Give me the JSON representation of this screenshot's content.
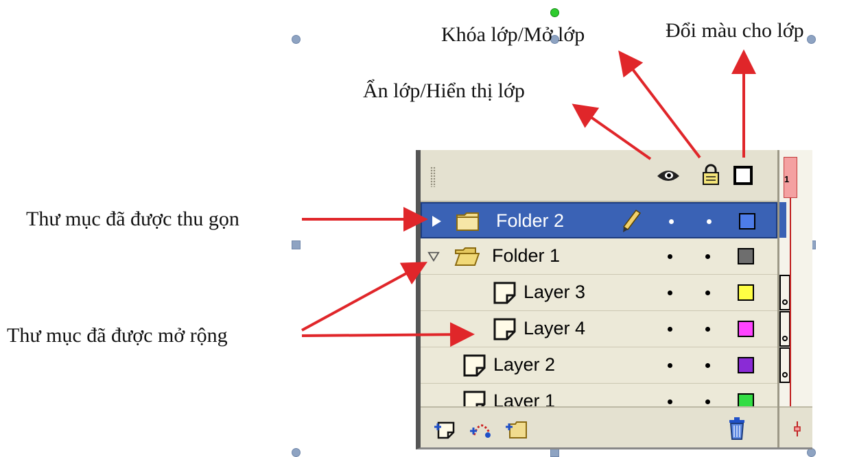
{
  "annotations": {
    "lock": "Khóa lớp/Mở lớp",
    "color": "Đổi màu cho lớp",
    "visibility": "Ẩn lớp/Hiển thị lớp",
    "collapsed": "Thư mục đã được thu gọn",
    "expanded": "Thư mục đã được mở rộng"
  },
  "panel": {
    "frame_number": "1",
    "layers": [
      {
        "name": "Folder 2",
        "kind": "folder",
        "state": "collapsed",
        "selected": true,
        "editing": true,
        "color": "#4d7ce8"
      },
      {
        "name": "Folder 1",
        "kind": "folder",
        "state": "expanded",
        "selected": false,
        "color": "#6e6e6e"
      },
      {
        "name": "Layer 3",
        "kind": "layer",
        "nested": true,
        "color": "#ffff44"
      },
      {
        "name": "Layer 4",
        "kind": "layer",
        "nested": true,
        "color": "#ff44ff"
      },
      {
        "name": "Layer 2",
        "kind": "layer",
        "nested": false,
        "color": "#8a2bd6"
      },
      {
        "name": "Layer 1",
        "kind": "layer",
        "nested": false,
        "color": "#33dd44"
      }
    ],
    "icons": {
      "header": [
        "eye-icon",
        "lock-icon",
        "outline-icon"
      ],
      "footer": [
        "insert-layer-icon",
        "add-motion-guide-icon",
        "insert-layer-folder-icon",
        "delete-layer-icon"
      ]
    },
    "colors": {
      "selection": "#3a62b5",
      "arrow": "#e0262a",
      "playhead": "#c02020",
      "panel_bg": "#ece9d8"
    }
  }
}
